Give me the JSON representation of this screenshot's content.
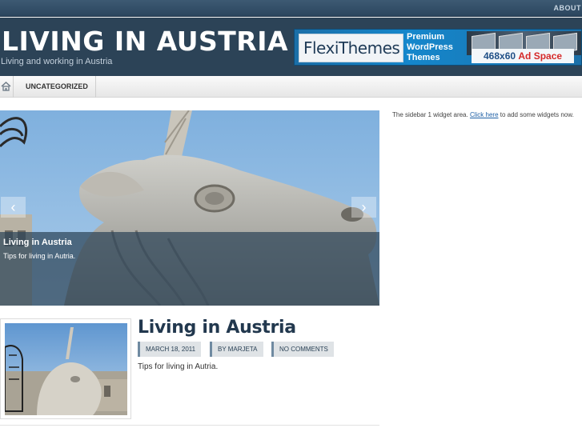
{
  "topbar": {
    "about_label": "ABOUT"
  },
  "header": {
    "site_title": "LIVING IN AUSTRIA",
    "site_description": "Living and working in Austria"
  },
  "ad_banner": {
    "logo_text": "FlexiThemes",
    "tagline_1": "Premium",
    "tagline_2": "WordPress",
    "tagline_3": "Themes",
    "size_label": "468x60",
    "space_label": "Ad Space"
  },
  "nav": {
    "home_icon": "home-icon",
    "items": [
      {
        "label": "UNCATEGORIZED"
      }
    ]
  },
  "slider": {
    "prev_icon": "chevron-left-icon",
    "next_icon": "chevron-right-icon",
    "caption_title": "Living in Austria",
    "caption_text": "Tips for living in Autria."
  },
  "post": {
    "title": "Living in Austria",
    "date": "MARCH 18, 2011",
    "author": "BY MARJETA",
    "comments": "NO COMMENTS",
    "excerpt": "Tips for living in Autria."
  },
  "sidebar": {
    "text_before": "The sidebar 1 widget area. ",
    "link_text": "Click here",
    "text_after": " to add some widgets now."
  },
  "colors": {
    "header_bg": "#2c4357",
    "accent": "#22384e"
  }
}
